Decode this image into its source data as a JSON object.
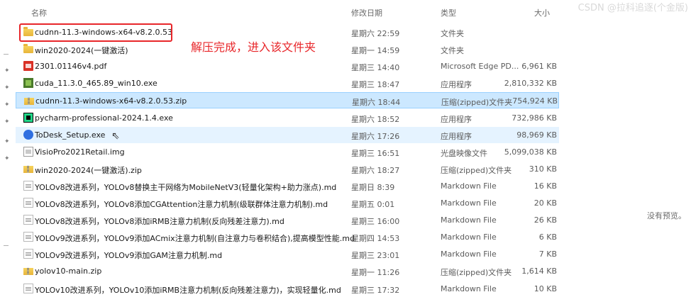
{
  "header": {
    "col_name": "名称",
    "col_date": "修改日期",
    "col_type": "类型",
    "col_size": "大小",
    "watermark": "CSDN @拉科追逐(个金版)"
  },
  "annotation": "解压完成，进入该文件夹",
  "preview_text": "没有预览。",
  "files": [
    {
      "name": "cudnn-11.3-windows-x64-v8.2.0.53",
      "date": "星期六 22:59",
      "type": "文件夹",
      "size": "",
      "icon": "folder-icon"
    },
    {
      "name": "win2020-2024(一键激活)",
      "date": "星期一 14:59",
      "type": "文件夹",
      "size": "",
      "icon": "folder-icon"
    },
    {
      "name": "2301.01146v4.pdf",
      "date": "星期三 14:40",
      "type": "Microsoft Edge PD...",
      "size": "6,961 KB",
      "icon": "pdf-icon"
    },
    {
      "name": "cuda_11.3.0_465.89_win10.exe",
      "date": "星期三 18:47",
      "type": "应用程序",
      "size": "2,810,332 KB",
      "icon": "cuda-installer-icon"
    },
    {
      "name": "cudnn-11.3-windows-x64-v8.2.0.53.zip",
      "date": "星期六 18:44",
      "type": "压缩(zipped)文件夹",
      "size": "754,924 KB",
      "icon": "zip-icon"
    },
    {
      "name": "pycharm-professional-2024.1.4.exe",
      "date": "星期六 18:52",
      "type": "应用程序",
      "size": "732,986 KB",
      "icon": "pycharm-installer-icon"
    },
    {
      "name": "ToDesk_Setup.exe",
      "date": "星期六 17:26",
      "type": "应用程序",
      "size": "98,969 KB",
      "icon": "todesk-installer-icon"
    },
    {
      "name": "VisioPro2021Retail.img",
      "date": "星期三 16:51",
      "type": "光盘映像文件",
      "size": "5,099,038 KB",
      "icon": "disc-image-icon"
    },
    {
      "name": "win2020-2024(一键激活).zip",
      "date": "星期六 18:27",
      "type": "压缩(zipped)文件夹",
      "size": "310 KB",
      "icon": "zip-icon"
    },
    {
      "name": "YOLOv8改进系列，YOLOv8替换主干网络为MobileNetV3(轻量化架构+助力涨点).md",
      "date": "星期日 8:39",
      "type": "Markdown File",
      "size": "16 KB",
      "icon": "markdown-file-icon"
    },
    {
      "name": "YOLOv8改进系列，YOLOv8添加CGAttention注意力机制(级联群体注意力机制).md",
      "date": "星期五 0:01",
      "type": "Markdown File",
      "size": "20 KB",
      "icon": "markdown-file-icon"
    },
    {
      "name": "YOLOv8改进系列，YOLOv8添加iRMB注意力机制(反向残差注意力).md",
      "date": "星期三 16:00",
      "type": "Markdown File",
      "size": "26 KB",
      "icon": "markdown-file-icon"
    },
    {
      "name": "YOLOv9改进系列，YOLOv9添加ACmix注意力机制(自注意力与卷积结合),提高模型性能.md",
      "date": "星期四 14:53",
      "type": "Markdown File",
      "size": "6 KB",
      "icon": "markdown-file-icon"
    },
    {
      "name": "YOLOv9改进系列，YOLOv9添加GAM注意力机制.md",
      "date": "星期三 23:01",
      "type": "Markdown File",
      "size": "7 KB",
      "icon": "markdown-file-icon"
    },
    {
      "name": "yolov10-main.zip",
      "date": "星期一 11:26",
      "type": "压缩(zipped)文件夹",
      "size": "1,614 KB",
      "icon": "zip-icon"
    },
    {
      "name": "YOLOv10改进系列，YOLOv10添加iRMB注意力机制(反向残差注意力)，实现轻量化.md",
      "date": "星期三 17:32",
      "type": "Markdown File",
      "size": "10 KB",
      "icon": "markdown-file-icon"
    }
  ]
}
